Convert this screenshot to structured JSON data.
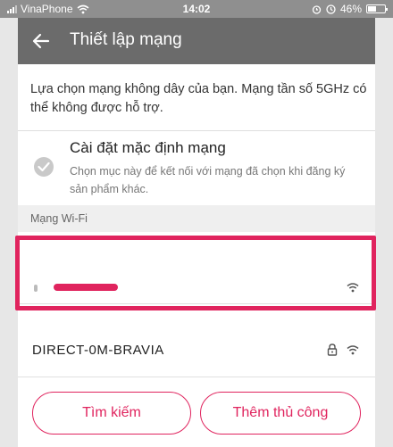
{
  "status_bar": {
    "carrier": "VinaPhone",
    "time": "14:02",
    "battery": "46%"
  },
  "header": {
    "title": "Thiết lập mạng"
  },
  "intro_text": "Lựa chọn mạng không dây của bạn. Mạng tần số 5GHz có thể không được hỗ trợ.",
  "default_network": {
    "title": "Cài đặt mặc định mạng",
    "description": "Chọn mục này để kết nối với mạng đã chọn khi đăng ký sản phẩm khác.",
    "checked": false
  },
  "wifi_section": {
    "label": "Mạng Wi-Fi",
    "networks": [
      {
        "name": "",
        "redacted": true,
        "secured": false
      },
      {
        "name": "DIRECT-0M-BRAVIA",
        "redacted": false,
        "secured": true
      }
    ]
  },
  "buttons": {
    "search": "Tìm kiếm",
    "manual": "Thêm thủ công"
  },
  "colors": {
    "accent": "#e0245e",
    "header_bg": "#6b6b6b",
    "status_bar_bg": "#8f8f8f"
  }
}
